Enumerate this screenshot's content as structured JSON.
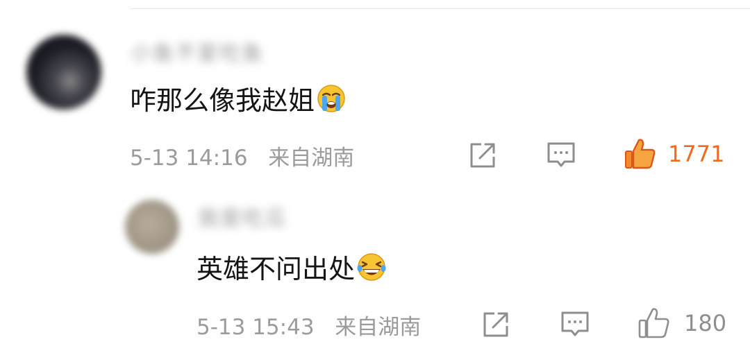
{
  "comments": [
    {
      "username": "小鱼不爱吃鱼",
      "text": "咋那么像我赵姐",
      "emoji": "crying-face",
      "time": "5-13 14:16",
      "location": "来自湖南",
      "likes": "1771",
      "liked": true
    },
    {
      "username": "我是吃瓜",
      "text": "英雄不问出处",
      "emoji": "laughing-face",
      "time": "5-13 15:43",
      "location": "来自湖南",
      "likes": "180",
      "liked": false
    }
  ],
  "colors": {
    "liked": "#ee6b22",
    "meta": "#9b9b9b",
    "text": "#141414",
    "icon": "#8e8e8e"
  }
}
